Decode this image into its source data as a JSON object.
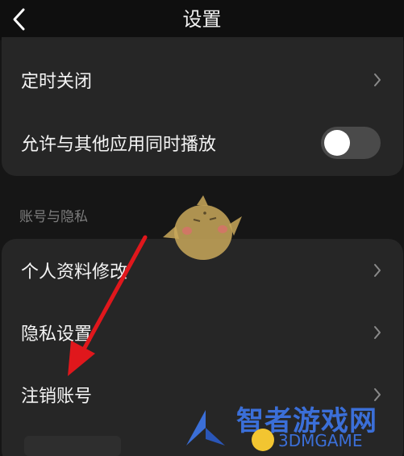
{
  "header": {
    "title": "设置"
  },
  "card1": {
    "items": [
      {
        "label": "定时关闭"
      },
      {
        "label": "允许与其他应用同时播放",
        "toggle_on": false
      }
    ]
  },
  "section": {
    "label": "账号与隐私"
  },
  "card2": {
    "items": [
      {
        "label": "个人资料修改"
      },
      {
        "label": "隐私设置"
      },
      {
        "label": "注销账号"
      }
    ]
  },
  "watermark": {
    "cn": "智者游戏网",
    "en": "3DMGAME"
  },
  "colors": {
    "background": "#161616",
    "card": "#262626",
    "arrow": "#e0171c",
    "watermark": "#3b6fd8"
  }
}
